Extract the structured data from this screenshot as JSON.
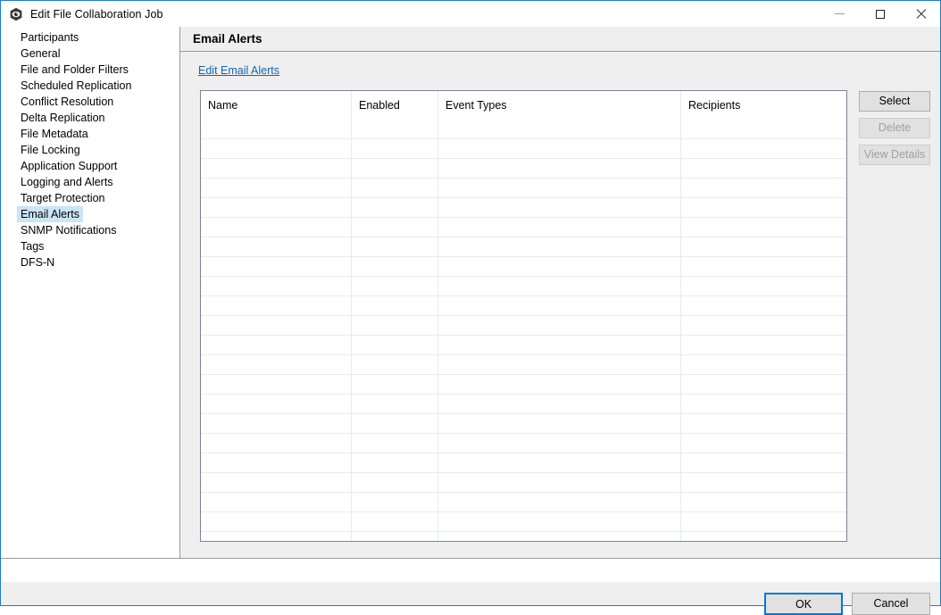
{
  "window": {
    "title": "Edit File Collaboration Job",
    "icon": "app-icon",
    "controls": {
      "minimize": "minimize-icon",
      "maximize": "maximize-icon",
      "close": "close-icon"
    },
    "accent_color": "#1c7ec4"
  },
  "sidebar": {
    "items": [
      {
        "label": "Participants",
        "selected": false
      },
      {
        "label": "General",
        "selected": false
      },
      {
        "label": "File and Folder Filters",
        "selected": false
      },
      {
        "label": "Scheduled Replication",
        "selected": false
      },
      {
        "label": "Conflict Resolution",
        "selected": false
      },
      {
        "label": "Delta Replication",
        "selected": false
      },
      {
        "label": "File Metadata",
        "selected": false
      },
      {
        "label": "File Locking",
        "selected": false
      },
      {
        "label": "Application Support",
        "selected": false
      },
      {
        "label": "Logging and Alerts",
        "selected": false
      },
      {
        "label": "Target Protection",
        "selected": false
      },
      {
        "label": "Email Alerts",
        "selected": true
      },
      {
        "label": "SNMP Notifications",
        "selected": false
      },
      {
        "label": "Tags",
        "selected": false
      },
      {
        "label": "DFS-N",
        "selected": false
      }
    ],
    "selection_color": "#cce4f7"
  },
  "main": {
    "title": "Email Alerts",
    "edit_link": "Edit Email Alerts",
    "link_color": "#1464b4",
    "table": {
      "columns": [
        "Name",
        "Enabled",
        "Event Types",
        "Recipients"
      ],
      "rows": [],
      "empty_row_count": 21
    },
    "side_buttons": [
      {
        "label": "Select",
        "enabled": true
      },
      {
        "label": "Delete",
        "enabled": false
      },
      {
        "label": "View Details",
        "enabled": false
      }
    ]
  },
  "footer": {
    "buttons": [
      {
        "label": "OK",
        "default": true
      },
      {
        "label": "Cancel",
        "default": false
      }
    ]
  }
}
